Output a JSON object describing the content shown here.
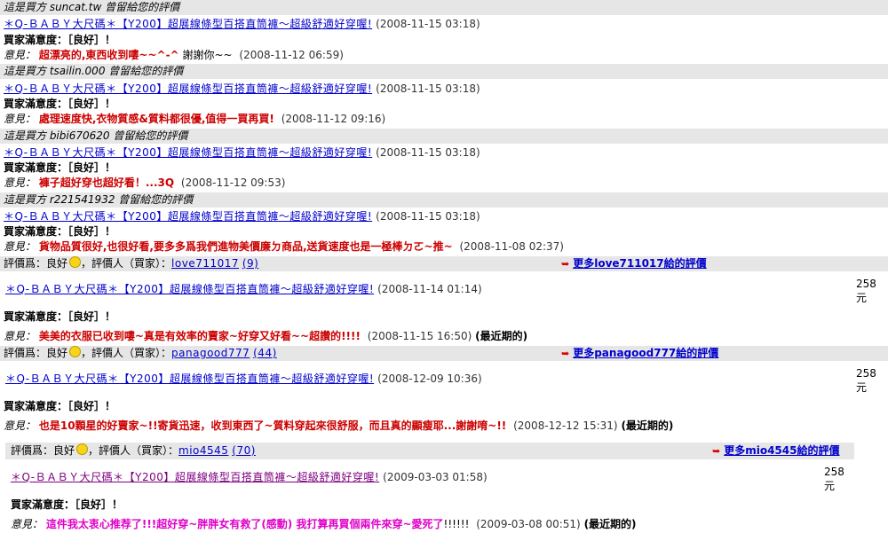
{
  "product_title": "＊Q-ＢＡＢＹ大尺碼＊【Y200】超展線條型百搭直筒褲～超級舒適好穿喔!",
  "satisfaction": "買家滿意度：［良好］！",
  "opinion_label": "意見：",
  "recent_label": "(最近期的)",
  "price": "258",
  "price_unit": "元",
  "notices": [
    {
      "buyer_notice": "這是買方 suncat.tw 曾留給您的評價",
      "item_date": "(2008-11-15 03:18)",
      "opinion": "超漂亮的,東西收到嘍~~^-^",
      "opinion_extra": "謝謝你~~",
      "opinion_date": "(2008-11-12 06:59)"
    },
    {
      "buyer_notice": "這是買方 tsailin.000 曾留給您的評價",
      "item_date": "(2008-11-15 03:18)",
      "opinion": "處理速度快,衣物質感&質料都很優,值得一買再買!",
      "opinion_date": "(2008-11-12 09:16)"
    },
    {
      "buyer_notice": "這是買方 bibi670620 曾留給您的評價",
      "item_date": "(2008-11-15 03:18)",
      "opinion": "褲子超好穿也超好看！...3Q",
      "opinion_date": "(2008-11-12 09:53)"
    },
    {
      "buyer_notice": "這是買方 r221541932 曾留給您的評價",
      "item_date": "(2008-11-15 03:18)",
      "opinion": "貨物品質很好,也很好看,要多多爲我們進物美價廉ㄉ商品,送貨速度也是一極棒ㄉㄛ~推~",
      "opinion_date": "(2008-11-08 02:37)"
    }
  ],
  "ratings": [
    {
      "rating_label": "評價爲：良好",
      "rater_label": "，評價人（買家）：",
      "rater": "love711017",
      "count": "(9)",
      "more": "更多love711017給的評價",
      "item_date": "(2008-11-14 01:14)",
      "opinion": "美美的衣服已收到嘍~真是有效率的賣家~好穿又好看~~超讚的!!!!",
      "opinion_date": "(2008-11-15 16:50)"
    },
    {
      "rating_label": "評價爲：良好",
      "rater_label": "，評價人（買家）：",
      "rater": "panagood777",
      "count": "(44)",
      "more": "更多panagood777給的評價",
      "item_date": "(2008-12-09 10:36)",
      "opinion": "也是10顆星的好賣家~!!寄貨迅速，收到東西了~質料穿起來很舒服，而且真的顯瘦耶...謝謝唷~!!",
      "opinion_date": "(2008-12-12 15:31)"
    },
    {
      "rating_label": "評價爲：良好",
      "rater_label": "，評價人（買家）：",
      "rater": "mio4545",
      "count": "(70)",
      "more": "更多mio4545給的評價",
      "item_date": "(2009-03-03 01:58)",
      "opinion": "這件我太衷心推荐了!!!超好穿~胖胖女有救了(感動) 我打算再買個兩件來穿~愛死了",
      "opinion_extra": "!!!!!!",
      "opinion_date": "(2009-03-08 00:51)"
    }
  ]
}
